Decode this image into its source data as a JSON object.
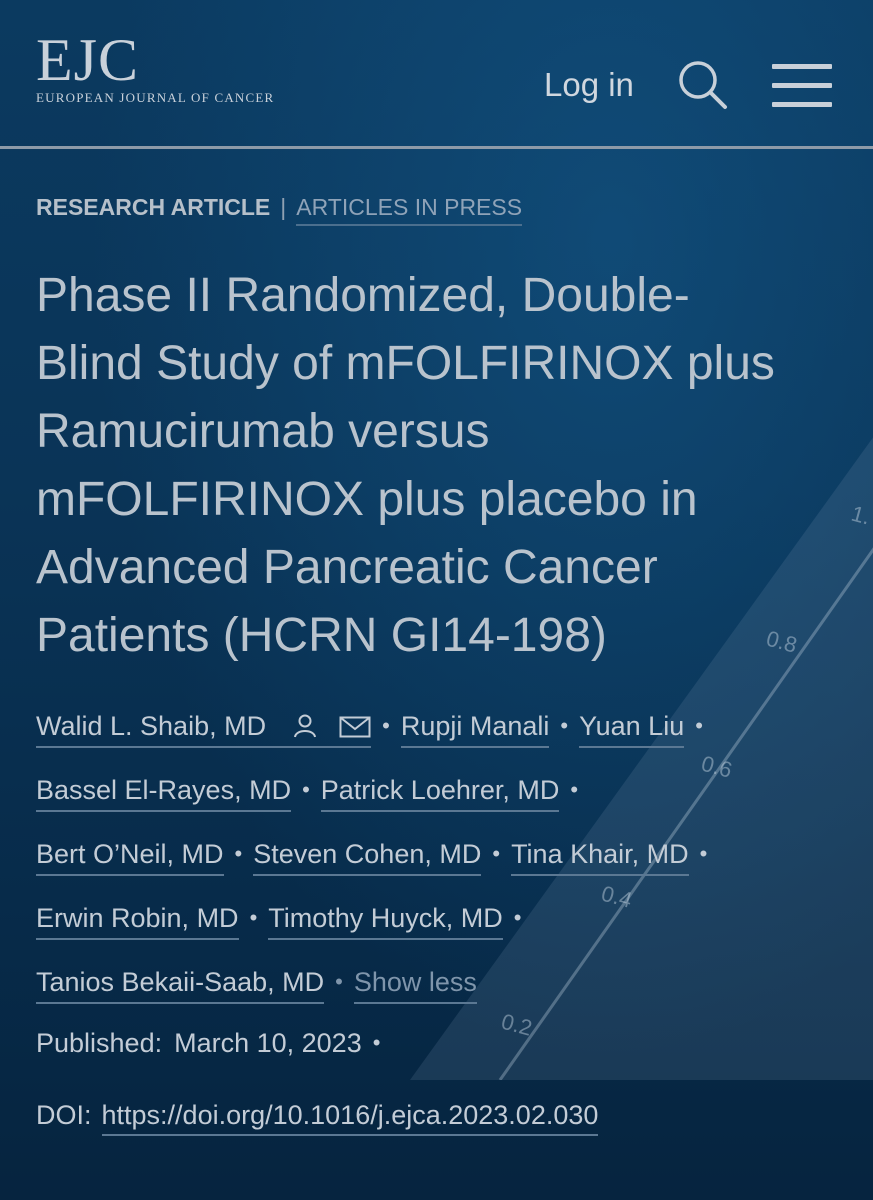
{
  "header": {
    "logo_mark": "EJC",
    "logo_subtitle": "EUROPEAN JOURNAL OF CANCER",
    "login_label": "Log in"
  },
  "article_meta": {
    "article_type": "RESEARCH ARTICLE",
    "separator": "|",
    "section": "ARTICLES IN PRESS"
  },
  "article": {
    "title_lines": [
      "Phase II Randomized, Double-",
      "Blind Study of mFOLFIRINOX plus",
      "Ramucirumab versus",
      "mFOLFIRINOX plus placebo in",
      "Advanced Pancreatic Cancer",
      "Patients (HCRN GI14-198)"
    ]
  },
  "authors": {
    "list": [
      "Walid L. Shaib, MD",
      "Rupji Manali",
      "Yuan Liu",
      "Bassel El-Rayes, MD",
      "Patrick Loehrer, MD",
      "Bert O’Neil, MD",
      "Steven Cohen, MD",
      "Tina Khair, MD",
      "Erwin Robin, MD",
      "Timothy Huyck, MD",
      "Tanios Bekaii-Saab, MD"
    ],
    "toggle_label": "Show less",
    "bullet": "•"
  },
  "publication": {
    "published_label": "Published:",
    "published_date": "March 10, 2023",
    "doi_label": "DOI:",
    "doi_url": "https://doi.org/10.1016/j.ejca.2023.02.030"
  },
  "background_chart_ticks": [
    "0.8",
    "0.6",
    "0.4",
    "0.2",
    "1."
  ],
  "icons": [
    "search-icon",
    "menu-icon",
    "person-icon",
    "mail-icon"
  ],
  "colors": {
    "background": "#072a47",
    "text": "#c3ccd6",
    "muted_link": "#7f95ab",
    "header_rule": "#8d9aa8"
  }
}
